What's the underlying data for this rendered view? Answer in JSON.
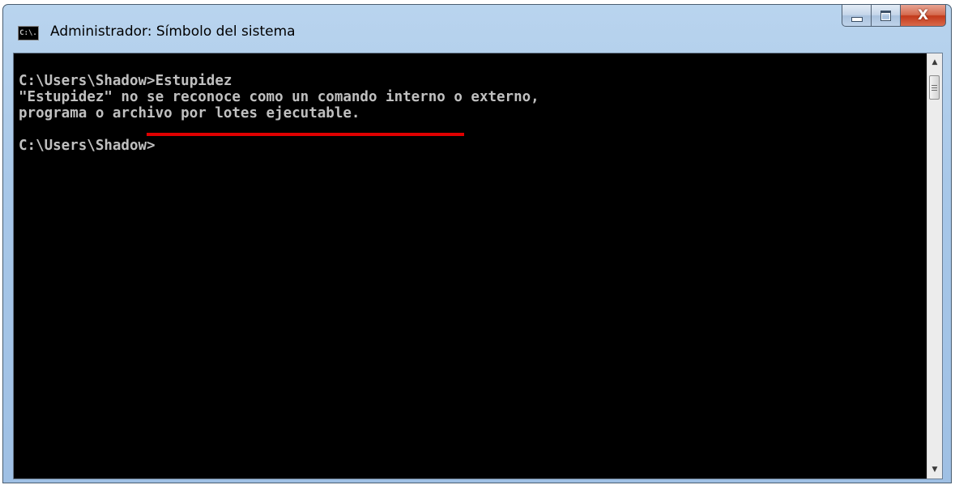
{
  "window": {
    "title": "Administrador: Símbolo del sistema",
    "icon_label": "C:\\.",
    "icon": "cmd-icon",
    "buttons": {
      "minimize": "minimize-icon",
      "maximize": "maximize-icon",
      "close_label": "X"
    }
  },
  "console": {
    "lines": [
      "C:\\Users\\Shadow>Estupidez",
      "\"Estupidez\" no se reconoce como un comando interno o externo,",
      "programa o archivo por lotes ejecutable.",
      "",
      "C:\\Users\\Shadow>"
    ],
    "text_color": "#c0c0c0",
    "background": "#000000",
    "highlight_color": "#e00000",
    "highlighted_phrase": "archivo por lotes ejecutable"
  },
  "scrollbar": {
    "up_arrow": "▲",
    "down_arrow": "▼"
  }
}
